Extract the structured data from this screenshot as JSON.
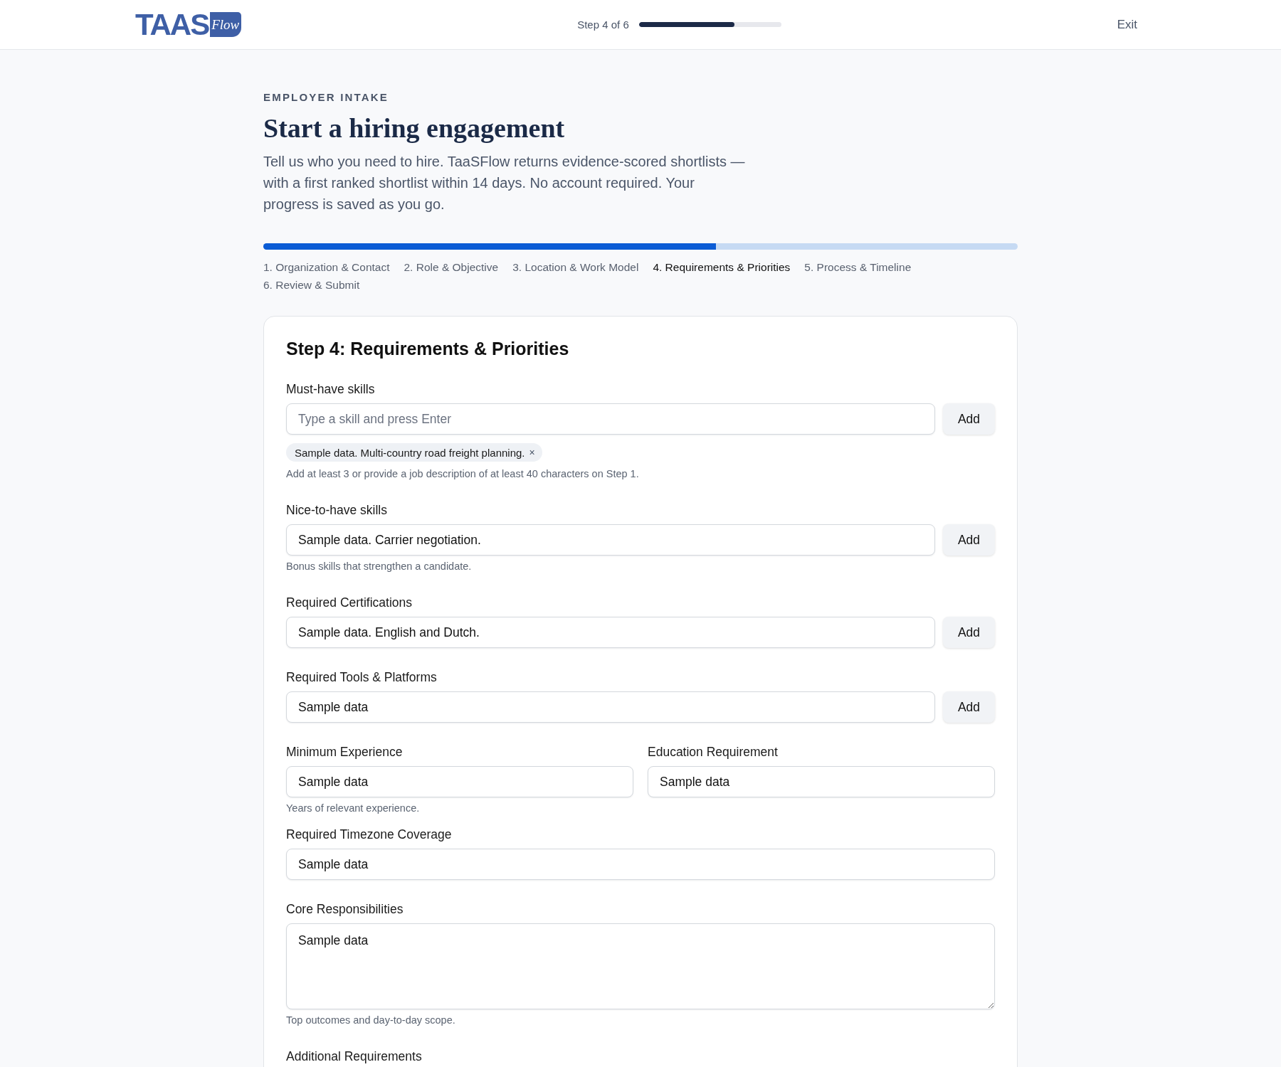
{
  "header": {
    "logo": {
      "wordmark": "TAAS",
      "script": "Flow"
    },
    "step_label": "Step 4 of 6",
    "progress": {
      "level": 0.67
    },
    "exit": "Exit"
  },
  "intro": {
    "eyebrow": "EMPLOYER INTAKE",
    "title": "Start a hiring engagement",
    "description": "Tell us who you need to hire. TaaSFlow returns evidence-scored shortlists — with a first ranked shortlist within 14 days. No account required. Your progress is saved as you go."
  },
  "stepper": {
    "progress": {
      "level": 0.6
    },
    "steps": [
      {
        "label": "1. Organization & Contact",
        "selected": false
      },
      {
        "label": "2. Role & Objective",
        "selected": false
      },
      {
        "label": "3. Location & Work Model",
        "selected": false
      },
      {
        "label": "4. Requirements & Priorities",
        "selected": true
      },
      {
        "label": "5. Process & Timeline",
        "selected": false
      },
      {
        "label": "6. Review & Submit",
        "selected": false
      }
    ]
  },
  "form": {
    "title": "Step 4: Requirements & Priorities",
    "fields": [
      {
        "kind": "tag_input",
        "label": "Must-have skills",
        "placeholder": "Type a skill and press Enter",
        "button": "Add",
        "tags": [
          {
            "label": "Sample data. Multi-country road freight planning.",
            "remove": "×"
          }
        ],
        "hint": "Add at least 3 or provide a job description of at least 40 characters on Step 1."
      },
      {
        "kind": "tag_input",
        "label": "Nice-to-have skills",
        "value": "Sample data. Carrier negotiation.",
        "button": "Add",
        "hint": "Bonus skills that strengthen a candidate."
      },
      {
        "kind": "tag_input",
        "label": "Required Certifications",
        "value": "Sample data. English and Dutch.",
        "button": "Add"
      },
      {
        "kind": "tag_input",
        "label": "Required Tools & Platforms",
        "value": "Sample data",
        "button": "Add"
      },
      {
        "kind": "pair",
        "columns": [
          {
            "label": "Minimum Experience",
            "value": "Sample data",
            "hint": "Years of relevant experience."
          },
          {
            "label": "Education Requirement",
            "value": "Sample data"
          }
        ]
      },
      {
        "kind": "text",
        "label": "Required Timezone Coverage",
        "value": "Sample data"
      },
      {
        "kind": "textarea",
        "label": "Core Responsibilities",
        "value": "Sample data",
        "hint": "Top outcomes and day-to-day scope."
      },
      {
        "kind": "label",
        "label": "Additional Requirements"
      }
    ]
  }
}
